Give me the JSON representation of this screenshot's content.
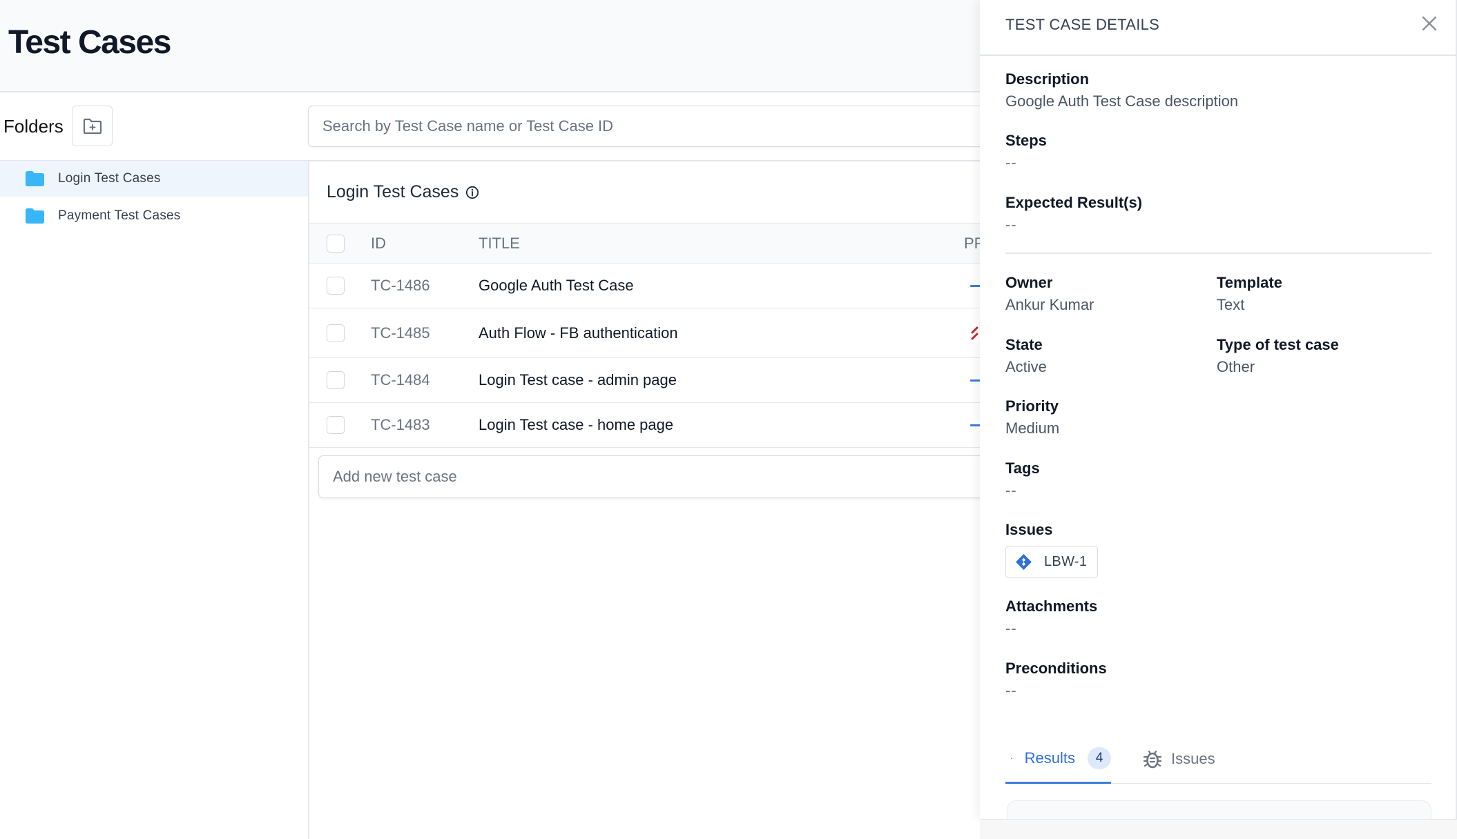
{
  "header": {
    "title": "Test Cases"
  },
  "toolbar": {
    "folders_label": "Folders",
    "new_folder_icon": "folder-plus-icon",
    "search_placeholder": "Search by Test Case name or Test Case ID"
  },
  "sidebar": {
    "folders": [
      {
        "label": "Login Test Cases",
        "selected": true,
        "icon": "folder-icon"
      },
      {
        "label": "Payment Test Cases",
        "selected": false,
        "icon": "folder-icon"
      }
    ]
  },
  "main": {
    "section_title": "Login Test Cases",
    "info_icon": "info-icon",
    "table": {
      "columns": [
        "ID",
        "TITLE",
        "PR"
      ],
      "rows": [
        {
          "id": "TC-1486",
          "title": "Google Auth Test Case",
          "priority": "medium"
        },
        {
          "id": "TC-1485",
          "title": "Auth Flow - FB authentication",
          "priority": "high"
        },
        {
          "id": "TC-1484",
          "title": "Login Test case - admin page",
          "priority": "medium"
        },
        {
          "id": "TC-1483",
          "title": "Login Test case - home page",
          "priority": "medium"
        }
      ]
    },
    "add_placeholder": "Add new test case"
  },
  "details": {
    "title": "TEST CASE DETAILS",
    "close_icon": "close-icon",
    "description": {
      "label": "Description",
      "value": "Google Auth Test Case description"
    },
    "steps": {
      "label": "Steps",
      "value": "--"
    },
    "expected": {
      "label": "Expected Result(s)",
      "value": "--"
    },
    "owner": {
      "label": "Owner",
      "value": "Ankur Kumar"
    },
    "template": {
      "label": "Template",
      "value": "Text"
    },
    "state": {
      "label": "State",
      "value": "Active"
    },
    "type": {
      "label": "Type of test case",
      "value": "Other"
    },
    "priority": {
      "label": "Priority",
      "value": "Medium"
    },
    "tags": {
      "label": "Tags",
      "value": "--"
    },
    "issues": {
      "label": "Issues",
      "items": [
        {
          "key": "LBW-1",
          "icon": "jira-icon"
        }
      ]
    },
    "attachments": {
      "label": "Attachments",
      "value": "--"
    },
    "preconditions": {
      "label": "Preconditions",
      "value": "--"
    },
    "tabs": [
      {
        "label": "Results",
        "count": "4",
        "icon": "bar-chart-icon",
        "active": true
      },
      {
        "label": "Issues",
        "icon": "bug-icon",
        "active": false
      }
    ]
  },
  "colors": {
    "accent": "#3b7ddd",
    "folder": "#38b6f7",
    "priority_high": "#c62828",
    "selected_bg": "#eef5fd"
  }
}
